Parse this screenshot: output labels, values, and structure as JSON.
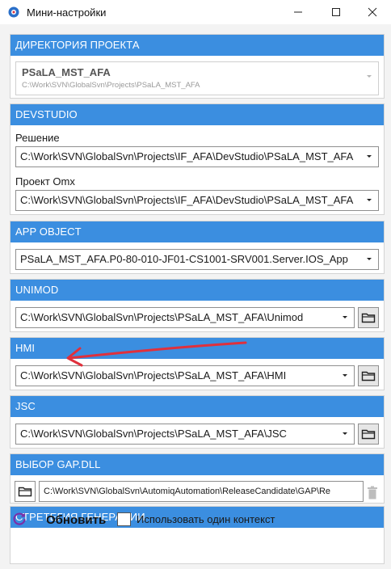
{
  "window": {
    "title": "Мини-настройки"
  },
  "project_dir": {
    "header": "ДИРЕКТОРИЯ ПРОЕКТА",
    "name": "PSaLA_MST_AFA",
    "path": "C:\\Work\\SVN\\GlobalSvn\\Projects\\PSaLA_MST_AFA"
  },
  "devstudio": {
    "header": "DEVSTUDIO",
    "solution_label": "Решение",
    "solution_value": "C:\\Work\\SVN\\GlobalSvn\\Projects\\IF_AFA\\DevStudio\\PSaLA_MST_AFA",
    "omx_label": "Проект Omx",
    "omx_value": "C:\\Work\\SVN\\GlobalSvn\\Projects\\IF_AFA\\DevStudio\\PSaLA_MST_AFA"
  },
  "app_object": {
    "header": "APP OBJECT",
    "value": "PSaLA_MST_AFA.P0-80-010-JF01-CS1001-SRV001.Server.IOS_App"
  },
  "unimod": {
    "header": "UNIMOD",
    "value": "C:\\Work\\SVN\\GlobalSvn\\Projects\\PSaLA_MST_AFA\\Unimod"
  },
  "hmi": {
    "header": "HMI",
    "value": "C:\\Work\\SVN\\GlobalSvn\\Projects\\PSaLA_MST_AFA\\HMI"
  },
  "jsc": {
    "header": "JSC",
    "value": "C:\\Work\\SVN\\GlobalSvn\\Projects\\PSaLA_MST_AFA\\JSC"
  },
  "gap_dll": {
    "header": "ВЫБОР GAP.DLL",
    "path": "C:\\Work\\SVN\\GlobalSvn\\AutomiqAutomation\\ReleaseCandidate\\GAP\\Re"
  },
  "strategy": {
    "header": "СТРЕТЕГИЯ ГЕНЕРАЦИИ",
    "refresh_label": "Обновить",
    "single_context_label": "Использовать один контекст"
  },
  "colors": {
    "header_bg": "#3b8ee0",
    "annotation_arrow": "#e0303c",
    "refresh_icon": "#7b2fa8"
  }
}
